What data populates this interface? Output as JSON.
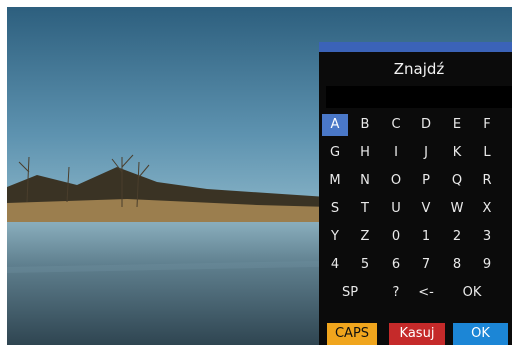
{
  "dialog": {
    "title": "Znajdź",
    "search_value": "",
    "active_key": "A",
    "keys": [
      [
        "A",
        "B",
        "C",
        "D",
        "E",
        "F"
      ],
      [
        "G",
        "H",
        "I",
        "J",
        "K",
        "L"
      ],
      [
        "M",
        "N",
        "O",
        "P",
        "Q",
        "R"
      ],
      [
        "S",
        "T",
        "U",
        "V",
        "W",
        "X"
      ],
      [
        "Y",
        "Z",
        "0",
        "1",
        "2",
        "3"
      ],
      [
        "4",
        "5",
        "6",
        "7",
        "8",
        "9"
      ],
      [
        "SP",
        "?",
        "<-",
        "OK"
      ]
    ],
    "function_keys": {
      "caps": "CAPS",
      "delete": "Kasuj",
      "ok": "OK"
    }
  },
  "colors": {
    "accent_bar": "#3b63b8",
    "key_highlight": "#4a78c8",
    "caps": "#f0a51d",
    "delete": "#c52a2a",
    "ok": "#1c86d6"
  }
}
